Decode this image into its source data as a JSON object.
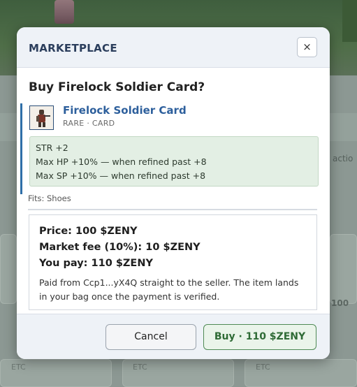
{
  "background": {
    "tab_label": "actio",
    "amount_text": "100",
    "tag_labels": [
      "ETC",
      "ETC",
      "ETC"
    ]
  },
  "modal": {
    "title": "MARKETPLACE",
    "close_label": "×",
    "heading": "Buy Firelock Soldier Card?",
    "item": {
      "name": "Firelock Soldier Card",
      "rarity": "RARE",
      "separator": "·",
      "type": "CARD",
      "icon": "firelock-soldier-sprite-icon"
    },
    "stats": [
      "STR +2",
      "Max HP +10% — when refined past +8",
      "Max SP +10% — when refined past +8"
    ],
    "fits_text": "Fits: Shoes",
    "payment": {
      "price": "Price: 100 $ZENY",
      "fee": "Market fee (10%): 10 $ZENY",
      "total": "You pay: 110 $ZENY",
      "note": "Paid from Ccp1...yX4Q straight to the seller. The item lands in your bag once the payment is verified."
    },
    "buttons": {
      "cancel": "Cancel",
      "buy": "Buy · 110 $ZENY"
    }
  },
  "colors": {
    "accent": "#2d5f9c",
    "buy_green": "#2f6b36",
    "stats_bg": "#e3efe4"
  }
}
